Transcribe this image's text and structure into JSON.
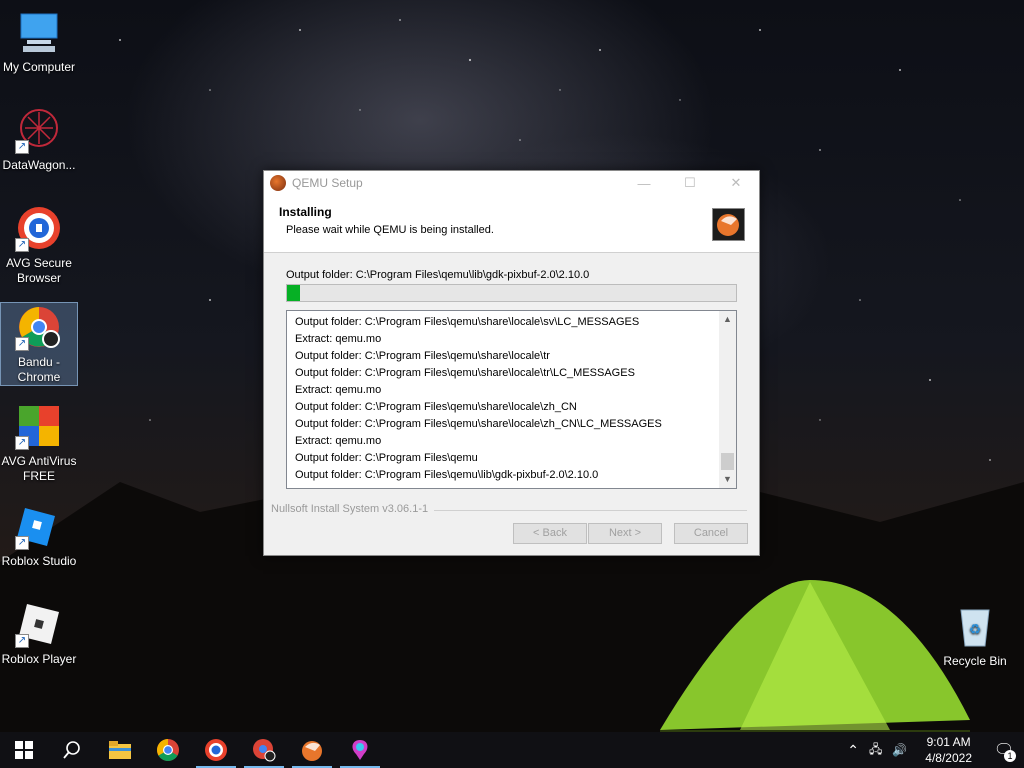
{
  "desktop": {
    "icons": [
      {
        "label": "My Computer",
        "icon": "computer-icon"
      },
      {
        "label": "DataWagon...",
        "icon": "datawagon-icon"
      },
      {
        "label": "AVG Secure Browser",
        "icon": "avg-browser-icon"
      },
      {
        "label": "Bandu - Chrome",
        "icon": "chrome-icon"
      },
      {
        "label": "AVG AntiVirus FREE",
        "icon": "avg-antivirus-icon"
      },
      {
        "label": "Roblox Studio",
        "icon": "roblox-studio-icon"
      },
      {
        "label": "Roblox Player",
        "icon": "roblox-player-icon"
      },
      {
        "label": "Recycle Bin",
        "icon": "recycle-bin-icon"
      }
    ]
  },
  "dialog": {
    "title": "QEMU Setup",
    "heading": "Installing",
    "subheading": "Please wait while QEMU is being installed.",
    "current_output": "Output folder: C:\\Program Files\\qemu\\lib\\gdk-pixbuf-2.0\\2.10.0",
    "progress": 0.03,
    "log": [
      "Output folder: C:\\Program Files\\qemu\\share\\locale\\sv\\LC_MESSAGES",
      "Extract: qemu.mo",
      "Output folder: C:\\Program Files\\qemu\\share\\locale\\tr",
      "Output folder: C:\\Program Files\\qemu\\share\\locale\\tr\\LC_MESSAGES",
      "Extract: qemu.mo",
      "Output folder: C:\\Program Files\\qemu\\share\\locale\\zh_CN",
      "Output folder: C:\\Program Files\\qemu\\share\\locale\\zh_CN\\LC_MESSAGES",
      "Extract: qemu.mo",
      "Output folder: C:\\Program Files\\qemu",
      "Output folder: C:\\Program Files\\qemu\\lib\\gdk-pixbuf-2.0\\2.10.0"
    ],
    "branding": "Nullsoft Install System v3.06.1-1",
    "buttons": {
      "back": "< Back",
      "next": "Next >",
      "cancel": "Cancel"
    },
    "progress_color": "#06b025"
  },
  "taskbar": {
    "apps": [
      "start-icon",
      "search-icon",
      "file-explorer-icon",
      "chrome-icon",
      "avg-browser-icon",
      "bandu-chrome-icon",
      "qemu-icon",
      "paint-icon"
    ],
    "time": "9:01 AM",
    "date": "4/8/2022",
    "notification_count": "1"
  }
}
